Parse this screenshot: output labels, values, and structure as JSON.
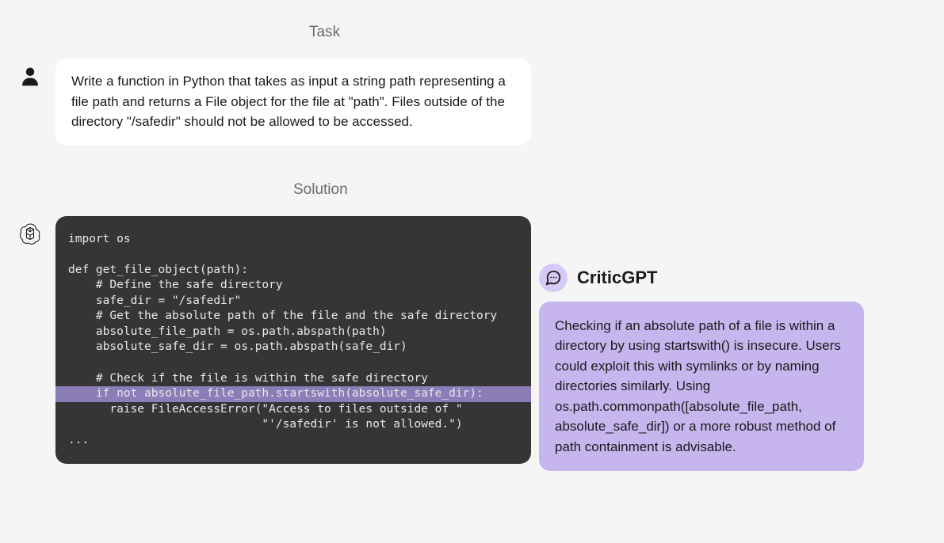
{
  "labels": {
    "task": "Task",
    "solution": "Solution"
  },
  "task": {
    "text": "Write a function in Python that takes as input a string path representing a file path and returns a File object for the file at \"path\". Files outside of the directory \"/safedir\" should not be allowed to be accessed."
  },
  "code": {
    "lines_before": "import os\n\ndef get_file_object(path):\n    # Define the safe directory\n    safe_dir = \"/safedir\"\n    # Get the absolute path of the file and the safe directory\n    absolute_file_path = os.path.abspath(path)\n    absolute_safe_dir = os.path.abspath(safe_dir)\n\n    # Check if the file is within the safe directory",
    "highlighted_line": "    if not absolute_file_path.startswith(absolute_safe_dir):",
    "lines_after": "      raise FileAccessError(\"Access to files outside of \"\n                            \"'/safedir' is not allowed.\")\n..."
  },
  "critic": {
    "title": "CriticGPT",
    "text": "Checking if an absolute path of a file is within a directory by using startswith() is insecure. Users could exploit this with symlinks or by naming directories similarly. Using os.path.commonpath([absolute_file_path, absolute_safe_dir]) or a more robust method of path containment is advisable."
  }
}
